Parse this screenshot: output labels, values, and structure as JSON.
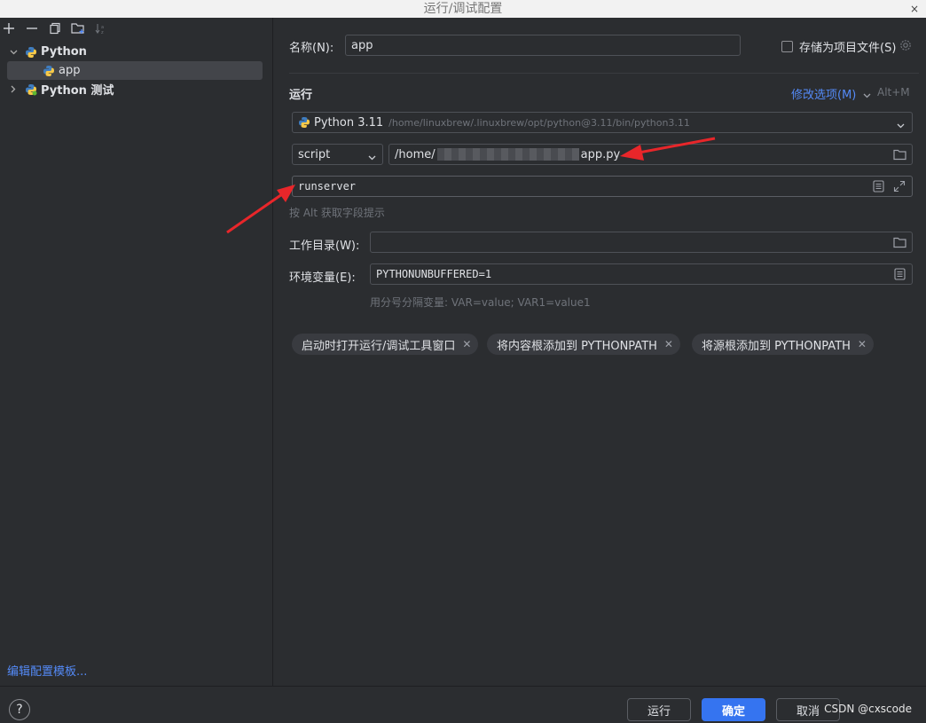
{
  "window": {
    "title": "运行/调试配置",
    "close_glyph": "×"
  },
  "toolbar": {
    "icons": [
      "add-icon",
      "remove-icon",
      "copy-icon",
      "new-folder-icon",
      "sort-icon"
    ]
  },
  "tree": {
    "python_label": "Python",
    "app_label": "app",
    "python_test_label": "Python 测试"
  },
  "edit_templates_link": "编辑配置模板...",
  "name_label": "名称(N):",
  "name_value": "app",
  "store_as_project_file": "存储为项目文件(S)",
  "section_run": "运行",
  "modify_options": "修改选项(M)",
  "modify_shortcut": "Alt+M",
  "interpreter": {
    "name": "Python 3.11",
    "path": "/home/linuxbrew/.linuxbrew/opt/python@3.11/bin/python3.11"
  },
  "script_type": "script",
  "script_path_prefix": "/home/",
  "script_path_suffix": "app.py",
  "parameters_value": "runserver",
  "parameters_hint": "按 Alt 获取字段提示",
  "working_dir_label": "工作目录(W):",
  "working_dir_value": "",
  "env_label": "环境变量(E):",
  "env_value": "PYTHONUNBUFFERED=1",
  "env_hint": "用分号分隔变量: VAR=value; VAR1=value1",
  "chips": [
    "启动时打开运行/调试工具窗口",
    "将内容根添加到 PYTHONPATH",
    "将源根添加到 PYTHONPATH"
  ],
  "buttons": {
    "help": "?",
    "run": "运行",
    "ok": "确定",
    "cancel": "取消"
  },
  "watermark": "CSDN @cxscode",
  "colors": {
    "accent": "#3574f0",
    "link": "#548af7",
    "annotation_arrow": "#e8262a"
  }
}
